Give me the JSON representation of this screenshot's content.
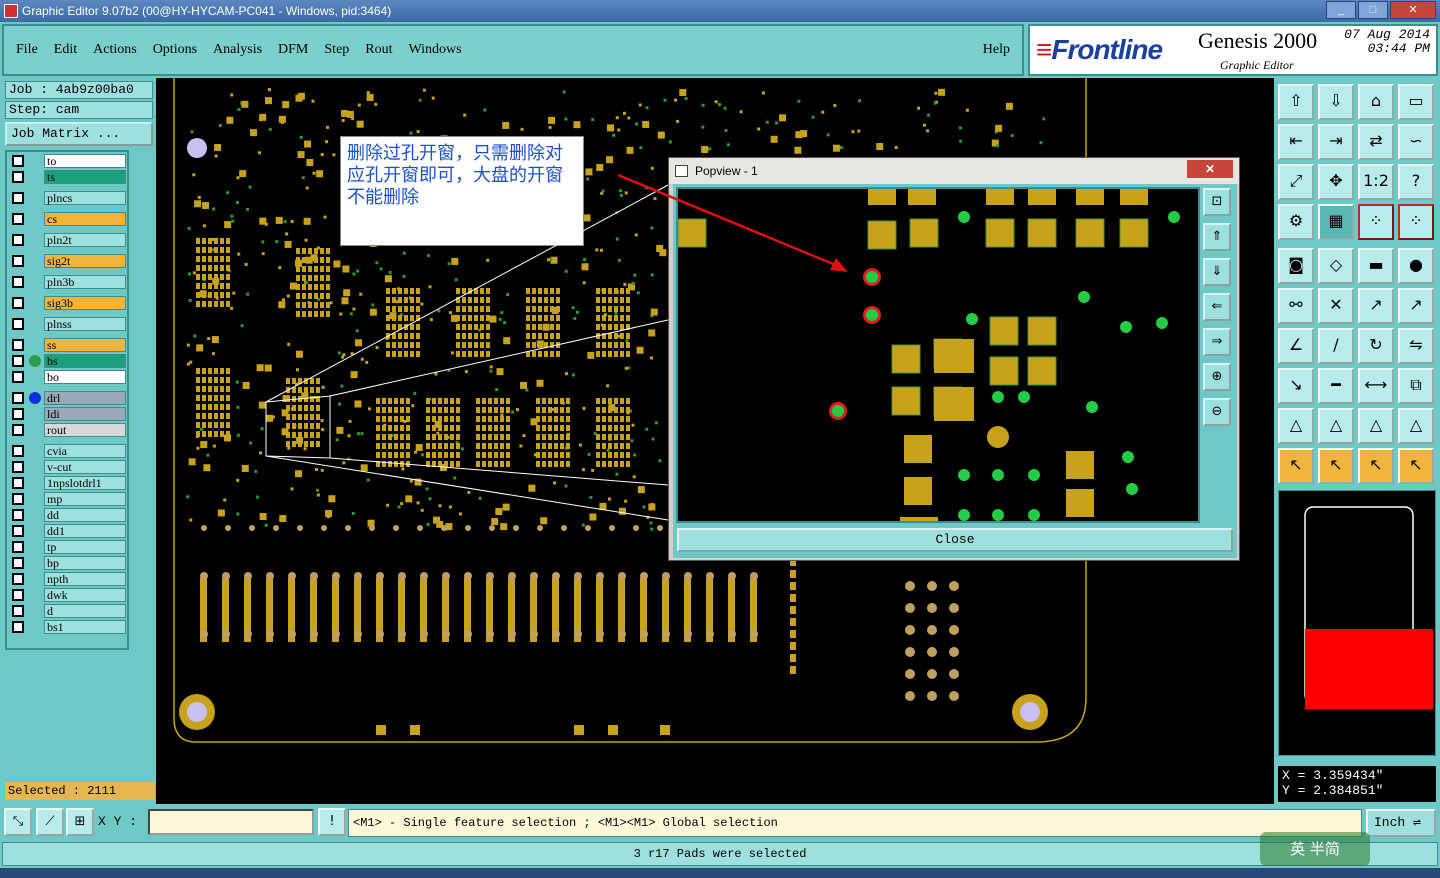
{
  "window": {
    "title": "Graphic Editor 9.07b2 (00@HY-HYCAM-PC041 - Windows, pid:3464)"
  },
  "menu": {
    "items": [
      "File",
      "Edit",
      "Actions",
      "Options",
      "Analysis",
      "DFM",
      "Step",
      "Rout",
      "Windows"
    ],
    "help": "Help"
  },
  "brand": {
    "logo_text": "Frontline",
    "product": "Genesis 2000",
    "subtitle": "Graphic Editor",
    "date": "07 Aug 2014",
    "time": "03:44 PM"
  },
  "job": {
    "job_label": "Job : 4ab9z00ba0",
    "step_label": "Step: cam",
    "matrix_button": "Job Matrix ..."
  },
  "layers": [
    {
      "name": "to",
      "color": "#ffffff"
    },
    {
      "name": "ts",
      "color": "#1aa07a"
    },
    {
      "name": "plncs",
      "color": "#9ee0de"
    },
    {
      "name": "cs",
      "color": "#f2b43a"
    },
    {
      "name": "pln2t",
      "color": "#9ee0de"
    },
    {
      "name": "sig2t",
      "color": "#f2b43a"
    },
    {
      "name": "pln3b",
      "color": "#9ee0de"
    },
    {
      "name": "sig3b",
      "color": "#f2b43a"
    },
    {
      "name": "plnss",
      "color": "#9ee0de"
    },
    {
      "name": "ss",
      "color": "#f2b43a"
    },
    {
      "name": "bs",
      "color": "#1aa07a"
    },
    {
      "name": "bo",
      "color": "#ffffff"
    },
    {
      "name": "drl",
      "color": "#9aa8b8"
    },
    {
      "name": "ldi",
      "color": "#9aa8b8"
    },
    {
      "name": "rout",
      "color": "#d8d8d8"
    },
    {
      "name": "cvia",
      "color": "#9ee0de"
    },
    {
      "name": "v-cut",
      "color": "#9ee0de"
    },
    {
      "name": "1npslotdrl1",
      "color": "#9ee0de"
    },
    {
      "name": "mp",
      "color": "#9ee0de"
    },
    {
      "name": "dd",
      "color": "#9ee0de"
    },
    {
      "name": "dd1",
      "color": "#9ee0de"
    },
    {
      "name": "tp",
      "color": "#9ee0de"
    },
    {
      "name": "bp",
      "color": "#9ee0de"
    },
    {
      "name": "npth",
      "color": "#9ee0de"
    },
    {
      "name": "dwk",
      "color": "#9ee0de"
    },
    {
      "name": "d",
      "color": "#9ee0de"
    },
    {
      "name": "bs1",
      "color": "#9ee0de"
    }
  ],
  "selected": "Selected : 2111",
  "popview": {
    "title": "Popview - 1",
    "close_label": "Close"
  },
  "note": {
    "text": "删除过孔开窗，只需删除对应孔开窗即可，大盘的开窗不能删除"
  },
  "coords": {
    "x": "X = 3.359434\"",
    "y": "Y = 2.384851\""
  },
  "bottom": {
    "xy_label": "X Y :",
    "xy_value": "",
    "hint": "<M1> - Single feature selection ; <M1><M1> Global selection",
    "unit": "Inch",
    "status": "3 r17 Pads were selected"
  },
  "watermark": "英  半简",
  "colors": {
    "pad": "#c8a21a",
    "via": "#22cc44",
    "highlight": "#e02020",
    "background": "#6ec8c5"
  }
}
